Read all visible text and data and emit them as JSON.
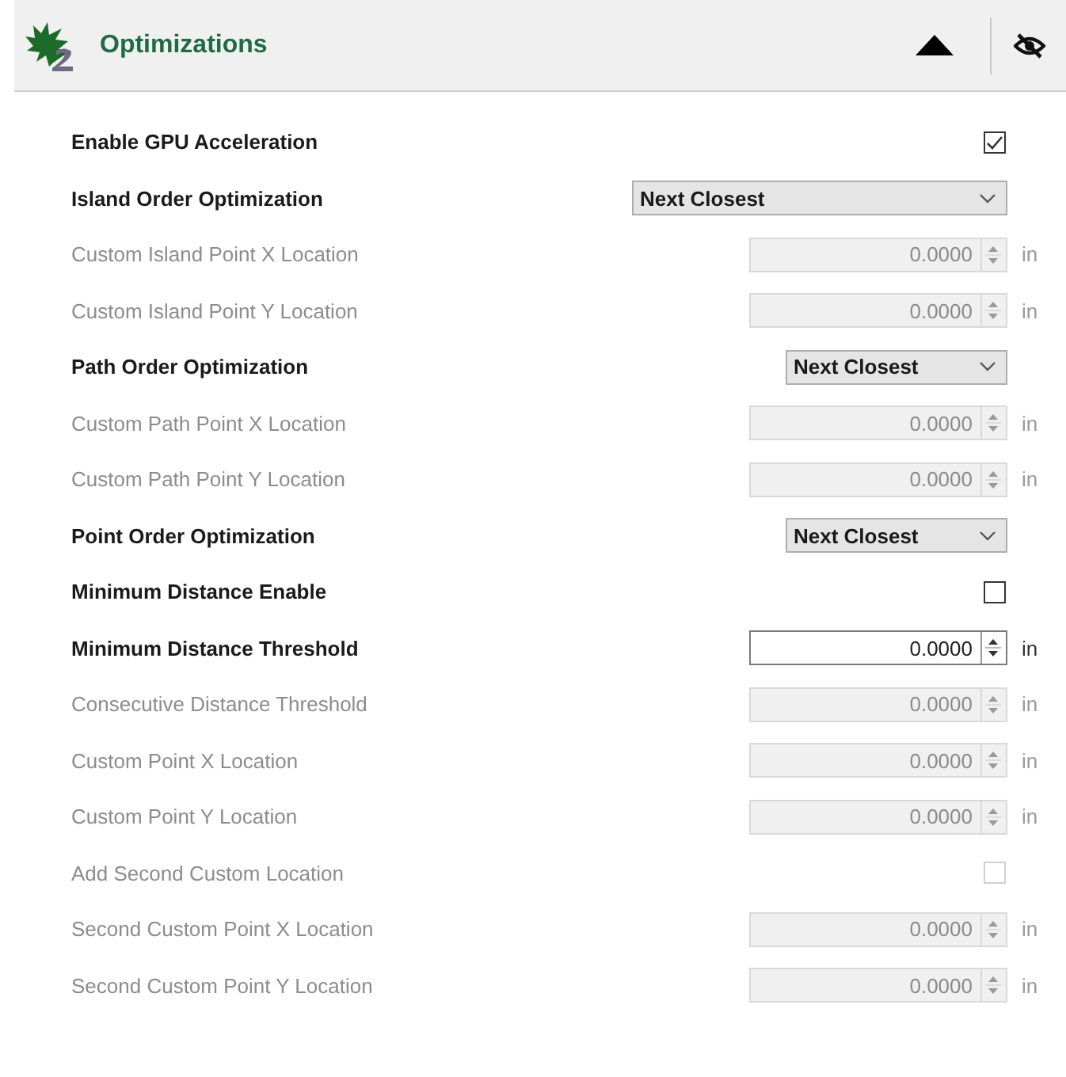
{
  "header": {
    "title": "Optimizations",
    "expanded": true
  },
  "rows": [
    {
      "kind": "checkbox",
      "label": "Enable GPU Acceleration",
      "disabled": false,
      "checked": true
    },
    {
      "kind": "dropdown",
      "label": "Island Order Optimization",
      "disabled": false,
      "value": "Next Closest"
    },
    {
      "kind": "number",
      "label": "Custom Island Point X Location",
      "disabled": true,
      "value": "0.0000",
      "unit": "in"
    },
    {
      "kind": "number",
      "label": "Custom Island Point Y Location",
      "disabled": true,
      "value": "0.0000",
      "unit": "in"
    },
    {
      "kind": "dropdown",
      "label": "Path Order Optimization",
      "disabled": false,
      "value": "Next Closest"
    },
    {
      "kind": "number",
      "label": "Custom Path Point X Location",
      "disabled": true,
      "value": "0.0000",
      "unit": "in"
    },
    {
      "kind": "number",
      "label": "Custom Path Point Y Location",
      "disabled": true,
      "value": "0.0000",
      "unit": "in"
    },
    {
      "kind": "dropdown",
      "label": "Point Order Optimization",
      "disabled": false,
      "value": "Next Closest"
    },
    {
      "kind": "checkbox",
      "label": "Minimum Distance Enable",
      "disabled": false,
      "checked": false
    },
    {
      "kind": "number",
      "label": "Minimum Distance Threshold",
      "disabled": false,
      "value": "0.0000",
      "unit": "in"
    },
    {
      "kind": "number",
      "label": "Consecutive Distance Threshold",
      "disabled": true,
      "value": "0.0000",
      "unit": "in"
    },
    {
      "kind": "number",
      "label": "Custom Point X Location",
      "disabled": true,
      "value": "0.0000",
      "unit": "in"
    },
    {
      "kind": "number",
      "label": "Custom Point Y Location",
      "disabled": true,
      "value": "0.0000",
      "unit": "in"
    },
    {
      "kind": "checkbox",
      "label": "Add Second Custom Location",
      "disabled": true,
      "checked": false
    },
    {
      "kind": "number",
      "label": "Second Custom Point X Location",
      "disabled": true,
      "value": "0.0000",
      "unit": "in"
    },
    {
      "kind": "number",
      "label": "Second Custom Point Y Location",
      "disabled": true,
      "value": "0.0000",
      "unit": "in"
    }
  ]
}
